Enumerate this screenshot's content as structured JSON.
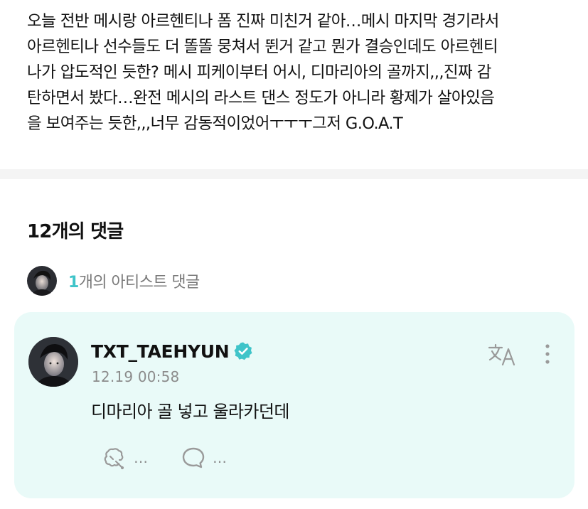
{
  "post": {
    "body_lines": [
      "오늘 전반 메시랑 아르헨티나 폼 진짜 미친거 같아…메시 마지막 경기라서",
      "아르헨티나 선수들도 더 똘똘 뭉쳐서 뛴거 같고 뭔가 결승인데도 아르헨티",
      "나가 압도적인 듯한? 메시 피케이부터 어시, 디마리아의 골까지,,,진짜 감",
      "탄하면서 봤다…완전 메시의 라스트 댄스 정도가 아니라 황제가 살아있음",
      "을 보여주는 듯한,,,너무 감동적이었어ㅜㅜㅜ그저 G.O.A.T"
    ]
  },
  "comments": {
    "title": "12개의 댓글",
    "artist_summary": {
      "count": "1",
      "label": "개의 아티스트 댓글"
    },
    "items": [
      {
        "author": "TXT_TAEHYUN",
        "verified_icon": "verified-badge-icon",
        "timestamp": "12.19 00:58",
        "text": "디마리아 골 넣고 울라카던데",
        "like_count": "…",
        "reply_count": "…"
      }
    ]
  },
  "icons": {
    "translate": "translate-icon",
    "more": "more-vertical-icon",
    "like": "reaction-icon",
    "reply": "speech-bubble-icon"
  },
  "colors": {
    "accent": "#3fc4c9",
    "card_background": "#e9faf8",
    "muted_text": "#8c8c8c",
    "icon_gray": "#9a9a9a"
  }
}
